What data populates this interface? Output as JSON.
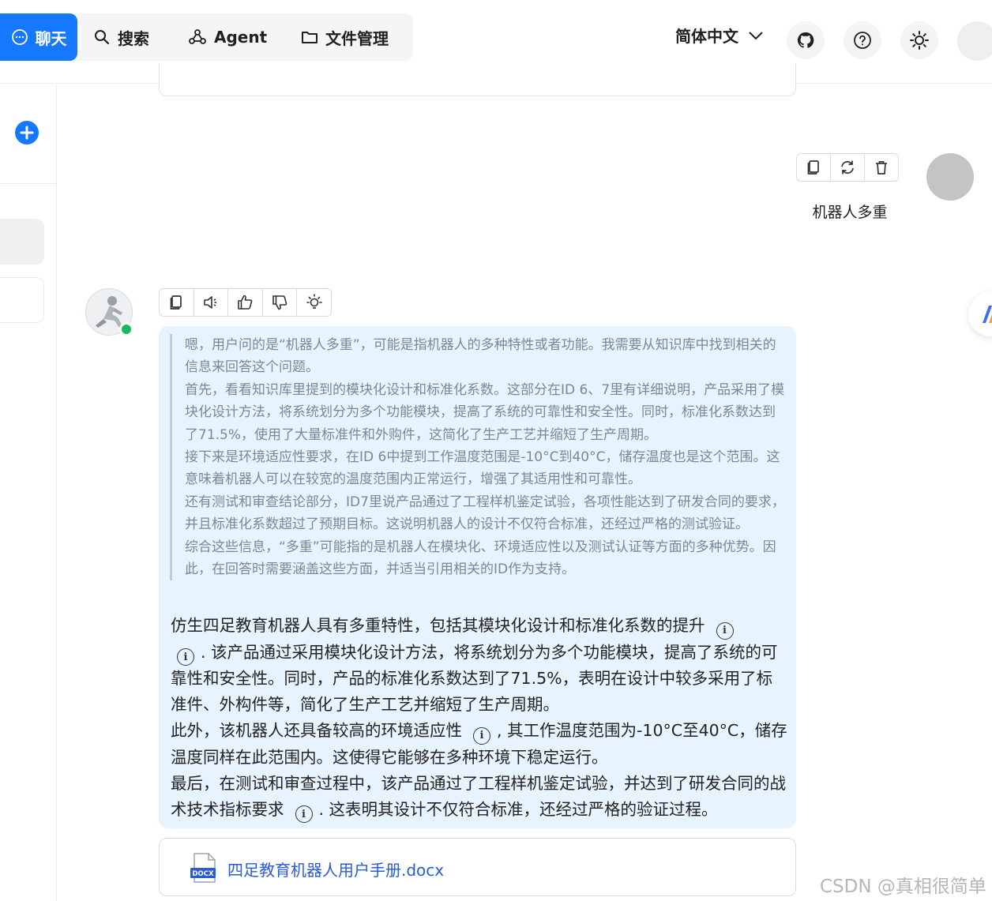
{
  "nav": {
    "chat_label": "聊天",
    "search_label": "搜索",
    "agent_label": "Agent",
    "files_label": "文件管理"
  },
  "header": {
    "language": "简体中文"
  },
  "user_message": {
    "text": "机器人多重"
  },
  "assistant": {
    "thinking": [
      "嗯，用户问的是“机器人多重”，可能是指机器人的多种特性或者功能。我需要从知识库中找到相关的信息来回答这个问题。",
      "首先，看看知识库里提到的模块化设计和标准化系数。这部分在ID 6、7里有详细说明，产品采用了模块化设计方法，将系统划分为多个功能模块，提高了系统的可靠性和安全性。同时，标准化系数达到了71.5%，使用了大量标准件和外购件，这简化了生产工艺并缩短了生产周期。",
      "接下来是环境适应性要求，在ID 6中提到工作温度范围是-10°C到40°C，储存温度也是这个范围。这意味着机器人可以在较宽的温度范围内正常运行，增强了其适用性和可靠性。",
      "还有测试和审查结论部分，ID7里说产品通过了工程样机鉴定试验，各项性能达到了研发合同的要求，并且标准化系数超过了预期目标。这说明机器人的设计不仅符合标准，还经过严格的测试验证。",
      "综合这些信息，“多重”可能指的是机器人在模块化、环境适应性以及测试认证等方面的多种优势。因此，在回答时需要涵盖这些方面，并适当引用相关的ID作为支持。"
    ],
    "answer": {
      "p1_a": "仿生四足教育机器人具有多重特性，包括其模块化设计和标准化系数的提升",
      "p1_b": ". 该产品通过采用模块化设计方法，将系统划分为多个功能模块，提高了系统的可靠性和安全性。同时，产品的标准化系数达到了71.5%，表明在设计中较多采用了标准件、外构件等，简化了生产工艺并缩短了生产周期。",
      "p2_a": "此外，该机器人还具备较高的环境适应性",
      "p2_b": ", 其工作温度范围为-10°C至40°C，储存温度同样在此范围内。这使得它能够在多种环境下稳定运行。",
      "p3_a": "最后，在测试和审查过程中，该产品通过了工程样机鉴定试验，并达到了研发合同的战术技术指标要求",
      "p3_b": ". 这表明其设计不仅符合标准，还经过严格的验证过程。",
      "cite_glyph": "i"
    },
    "file": {
      "badge": "DOCX",
      "name": "四足教育机器人用户手册.docx"
    }
  },
  "watermark": "CSDN @真相很简单",
  "colors": {
    "primary": "#1677ff",
    "answer_bg": "#e7f3fe",
    "online": "#19b85a",
    "file_link": "#2a5bd7"
  }
}
